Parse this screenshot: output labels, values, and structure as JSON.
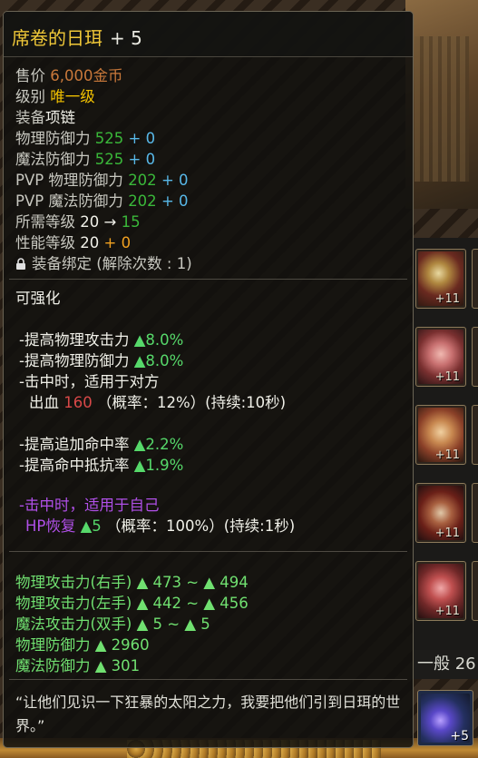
{
  "item": {
    "name": "席卷的日珥",
    "enhance": "+ 5"
  },
  "info": {
    "price_label": "售价",
    "price_value": "6,000金币",
    "grade_label": "级别",
    "grade_value": "唯一级",
    "equip_label": "装备",
    "equip_value": "项链",
    "pdef_label": "物理防御力",
    "pdef_value": "525",
    "pdef_bonus": "+ 0",
    "mdef_label": "魔法防御力",
    "mdef_value": "525",
    "mdef_bonus": "+ 0",
    "pvp_pdef_label": "PVP 物理防御力",
    "pvp_pdef_value": "202",
    "pvp_pdef_bonus": "+ 0",
    "pvp_mdef_label": "PVP 魔法防御力",
    "pvp_mdef_value": "202",
    "pvp_mdef_bonus": "+ 0",
    "req_level_label": "所需等级",
    "req_level_from": "20",
    "req_level_arrow": "→",
    "req_level_to": "15",
    "perf_level_label": "性能等级",
    "perf_level_value": "20",
    "perf_level_bonus": "+ 0",
    "bind_text": "装备绑定 (解除次数 : 1)"
  },
  "enhance": {
    "header": "可强化",
    "line1_text": "-提高物理攻击力",
    "line1_value": "▲8.0%",
    "line2_text": "-提高物理防御力",
    "line2_value": "▲8.0%",
    "line3_text": "-击中时，适用于对方",
    "line4_prefix": "出血",
    "line4_value": "160",
    "line4_rate": "（概率：12%）(持续:10秒)",
    "line5_text": "-提高追加命中率",
    "line5_value": "▲2.2%",
    "line6_text": "-提高命中抵抗率",
    "line6_value": "▲1.9%",
    "line7_text": "-击中时，适用于自己",
    "line8_prefix": "HP恢复",
    "line8_value": "▲5",
    "line8_rate": "（概率：100%）(持续:1秒)"
  },
  "stats": [
    {
      "label": "物理攻击力(右手)",
      "value": "▲ 473 ~ ▲ 494"
    },
    {
      "label": "物理攻击力(左手)",
      "value": "▲ 442 ~ ▲ 456"
    },
    {
      "label": "魔法攻击力(双手)",
      "value": "▲ 5 ~ ▲ 5"
    },
    {
      "label": "物理防御力",
      "value": "▲ 2960"
    },
    {
      "label": "魔法防御力",
      "value": "▲ 301"
    }
  ],
  "quote": "“让他们见识一下狂暴的太阳之力，我要把他们引到日珥的世界。”",
  "inventory": {
    "slot_counts": [
      "+11",
      "+11",
      "+11",
      "+11",
      "+11"
    ],
    "tab_label": "一般 26",
    "bottom_slot_count": "+5"
  },
  "colors": {
    "title": "#f0c838",
    "price": "#c8783a",
    "grade": "#f0c000",
    "base_value": "#3ab83a",
    "bonus_value": "#58b8e8",
    "stat_green": "#56d86a",
    "bleed": "#d84848",
    "self_effect": "#b050e8"
  }
}
